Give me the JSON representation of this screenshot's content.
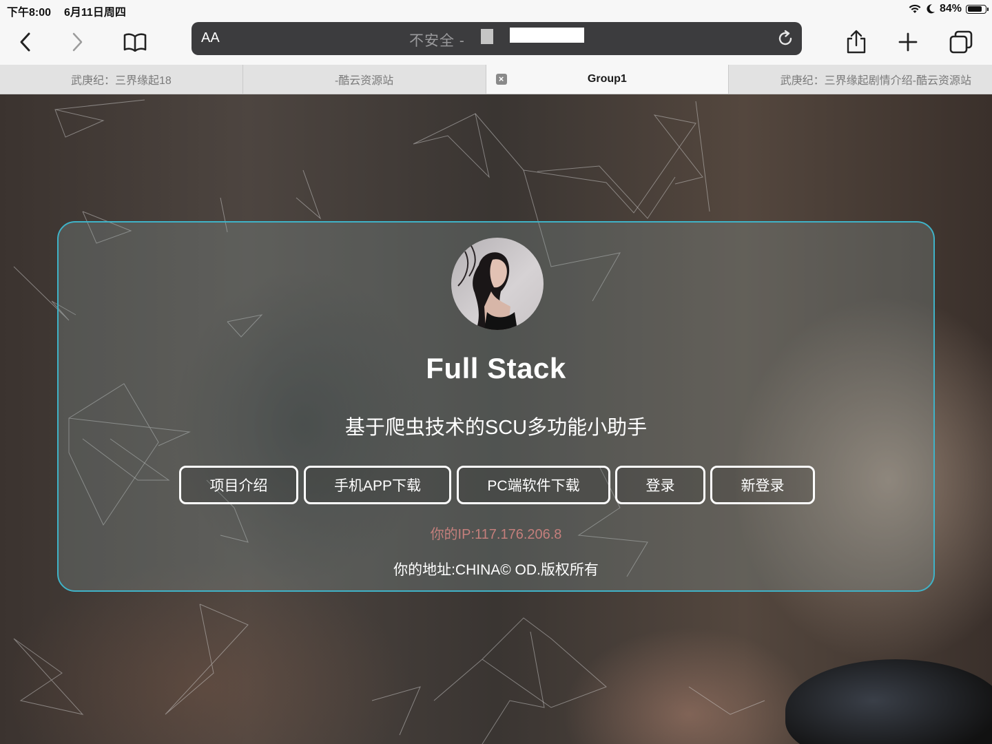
{
  "status_bar": {
    "time": "下午8:00",
    "date": "6月11日周四",
    "battery": "84%",
    "battery_level": 0.84
  },
  "toolbar": {
    "text_size_label": "AA",
    "url_text": "不安全 -"
  },
  "tabs": [
    {
      "label": "武庚纪：三界缘起18",
      "active": false
    },
    {
      "label": "-酷云资源站",
      "active": false
    },
    {
      "label": "Group1",
      "active": true
    },
    {
      "label": "武庚纪：三界缘起剧情介绍-酷云资源站",
      "active": false
    }
  ],
  "card": {
    "title": "Full Stack",
    "subtitle": "基于爬虫技术的SCU多功能小助手",
    "buttons": [
      "项目介绍",
      "手机APP下载",
      "PC端软件下载",
      "登录",
      "新登录"
    ],
    "ip_text": "你的IP:117.176.206.8",
    "address_text": "你的地址:CHINA© OD.版权所有"
  },
  "colors": {
    "card_border": "#3fb3c8",
    "ip_text": "#c47f7c",
    "address_bar": "#3c3c3e"
  }
}
